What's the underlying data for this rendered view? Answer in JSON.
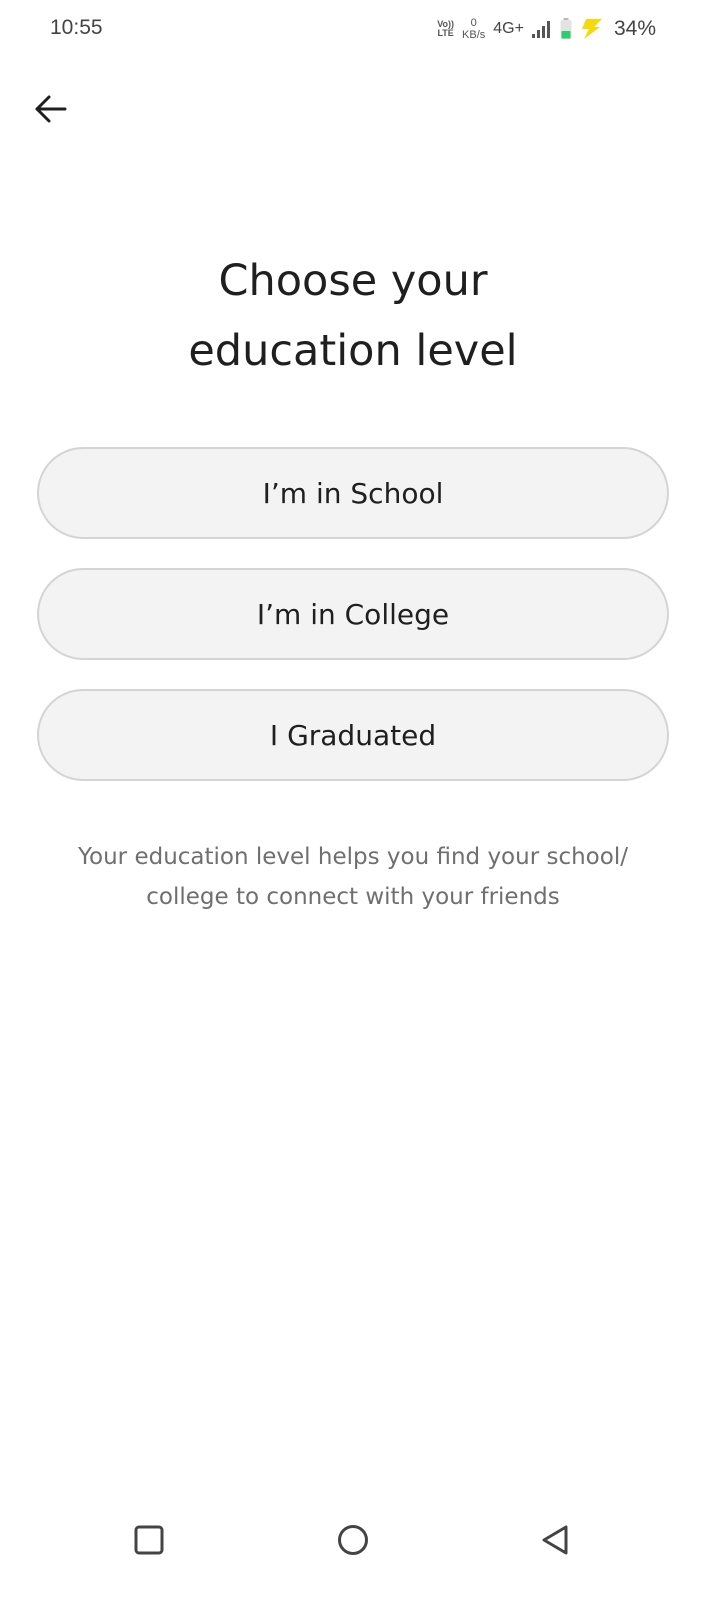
{
  "status_bar": {
    "time": "10:55",
    "volte_top": "Vo))",
    "volte_bottom": "LTE",
    "net_speed_value": "0",
    "net_speed_unit": "KB/s",
    "network_type": "4G+",
    "battery_percent": "34%",
    "battery_color": "#2ecc71",
    "charging_color": "#f5d90a"
  },
  "header": {
    "back_icon": "arrow-left-icon"
  },
  "main": {
    "title_line1": "Choose your",
    "title_line2": "education level",
    "options": [
      {
        "label": "I’m in School"
      },
      {
        "label": "I’m in College"
      },
      {
        "label": "I Graduated"
      }
    ],
    "helper_line1": "Your education level helps you find your school/",
    "helper_line2": "college to connect with your friends"
  },
  "nav_bar": {
    "recents_icon": "square-icon",
    "home_icon": "circle-icon",
    "back_icon": "triangle-back-icon"
  }
}
